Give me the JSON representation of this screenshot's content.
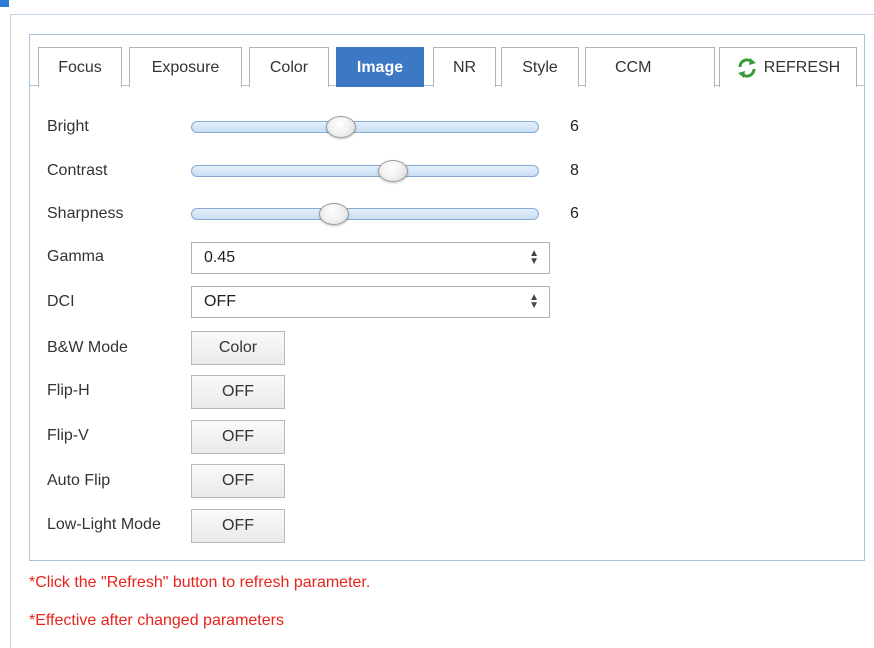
{
  "tabs": [
    {
      "label": "Focus",
      "active": false
    },
    {
      "label": "Exposure",
      "active": false
    },
    {
      "label": "Color",
      "active": false
    },
    {
      "label": "Image",
      "active": true
    },
    {
      "label": "NR",
      "active": false
    },
    {
      "label": "Style",
      "active": false
    },
    {
      "label": "CCM",
      "active": false
    }
  ],
  "refresh": {
    "label": "REFRESH",
    "icon": "refresh-icon"
  },
  "sliders": [
    {
      "label": "Bright",
      "value": "6",
      "fraction": 0.43
    },
    {
      "label": "Contrast",
      "value": "8",
      "fraction": 0.58
    },
    {
      "label": "Sharpness",
      "value": "6",
      "fraction": 0.41
    }
  ],
  "selects": [
    {
      "label": "Gamma",
      "value": "0.45"
    },
    {
      "label": "DCI",
      "value": "OFF"
    }
  ],
  "buttons": [
    {
      "label": "B&W Mode",
      "value": "Color"
    },
    {
      "label": "Flip-H",
      "value": "OFF"
    },
    {
      "label": "Flip-V",
      "value": "OFF"
    },
    {
      "label": "Auto Flip",
      "value": "OFF"
    },
    {
      "label": "Low-Light Mode",
      "value": "OFF"
    }
  ],
  "notes": [
    "*Click the \"Refresh\" button to refresh parameter.",
    "*Effective after changed parameters"
  ],
  "colors": {
    "accent": "#3d78c5",
    "note": "#e8231c",
    "panel_border": "#a9c3dd"
  }
}
